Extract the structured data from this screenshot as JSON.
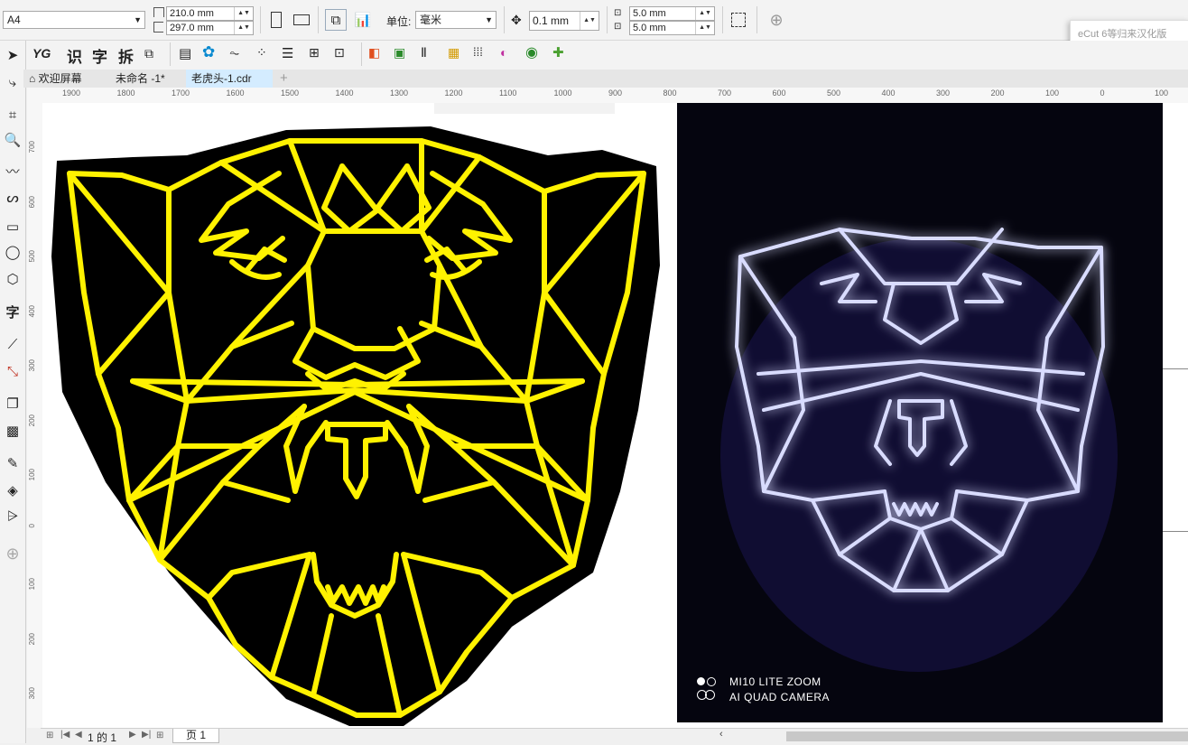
{
  "property_bar": {
    "page_size": "A4",
    "width": "210.0 mm",
    "height": "297.0 mm",
    "units_label": "单位:",
    "units_value": "毫米",
    "nudge": "0.1 mm",
    "dup_x": "5.0 mm",
    "dup_y": "5.0 mm"
  },
  "standard_bar": {
    "yg_label": "YG",
    "recognize_label": "识",
    "char_label": "字",
    "split_label": "拆"
  },
  "document_tabs": {
    "welcome": "欢迎屏幕",
    "untitled": "未命名 -1*",
    "active": "老虎头-1.cdr",
    "add": "+"
  },
  "ecut_popup": {
    "title": "eCut 6等归来汉化版"
  },
  "ruler": {
    "h_ticks": [
      "1900",
      "1800",
      "1700",
      "1600",
      "1500",
      "1400",
      "1300",
      "1200",
      "1100",
      "1000",
      "900",
      "800",
      "700",
      "600",
      "500",
      "400",
      "300",
      "200",
      "100",
      "0",
      "100"
    ],
    "v_ticks": [
      "700",
      "600",
      "500",
      "400",
      "300",
      "200",
      "100",
      "0",
      "100",
      "200",
      "300"
    ]
  },
  "photo": {
    "watermark_line1": "MI10 LITE ZOOM",
    "watermark_line2": "AI QUAD CAMERA"
  },
  "status_bar": {
    "page_info": "1 的 1",
    "page_tab": "页 1"
  },
  "colors": {
    "tiger_outline": "#FFF200",
    "tiger_fill": "#000000",
    "neon": "#d9dcff",
    "neon_glow": "#5a4cff",
    "photo_bg": "#05050f"
  }
}
